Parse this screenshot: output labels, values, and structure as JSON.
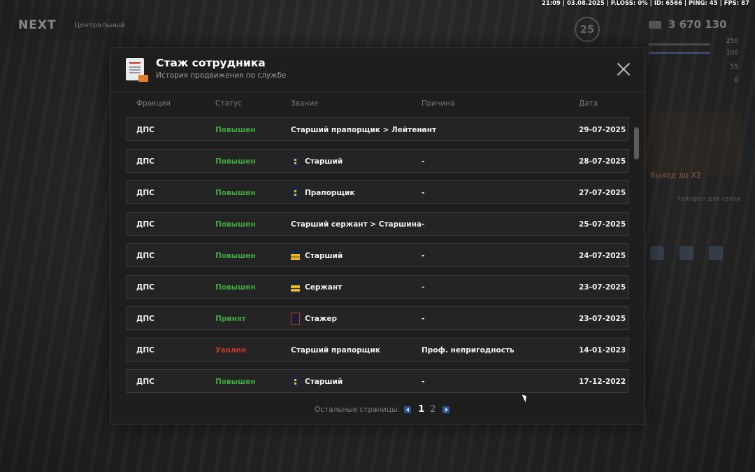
{
  "hud": {
    "status_line": "21:09 | 03.08.2025 | P.LOSS: 0% | ID: 6566 | PING: 45 | FPS: 87",
    "logo": "NEXT",
    "logo_sub": "Центральный",
    "level": "25",
    "money": "3 670 130",
    "stats": [
      "250",
      "100",
      "55",
      "0"
    ],
    "side_text": "Выход до X2",
    "side_text_2": "Телефон для связи"
  },
  "modal": {
    "title": "Стаж сотрудника",
    "subtitle": "История продвижения по службе",
    "columns": {
      "faction": "Фракция",
      "status": "Статус",
      "rank": "Звание",
      "reason": "Причина",
      "date": "Дата"
    },
    "rows": [
      {
        "faction": "ДПС",
        "status": "Повышен",
        "status_color": "#3fa83f",
        "rank_icon": "none",
        "rank": "Старший прапорщик > Лейтенант",
        "reason": "-",
        "date": "29-07-2025"
      },
      {
        "faction": "ДПС",
        "status": "Повышен",
        "status_color": "#3fa83f",
        "rank_icon": "star-shoulder-icon",
        "rank": "Старший",
        "reason": "-",
        "date": "28-07-2025"
      },
      {
        "faction": "ДПС",
        "status": "Повышен",
        "status_color": "#3fa83f",
        "rank_icon": "star-shoulder-icon",
        "rank": "Прапорщик",
        "reason": "-",
        "date": "27-07-2025"
      },
      {
        "faction": "ДПС",
        "status": "Повышен",
        "status_color": "#3fa83f",
        "rank_icon": "none",
        "rank": "Старший сержант > Старшина",
        "reason": "-",
        "date": "25-07-2025"
      },
      {
        "faction": "ДПС",
        "status": "Повышен",
        "status_color": "#3fa83f",
        "rank_icon": "stripe-shoulder-icon",
        "rank": "Старший",
        "reason": "-",
        "date": "24-07-2025"
      },
      {
        "faction": "ДПС",
        "status": "Повышен",
        "status_color": "#3fa83f",
        "rank_icon": "stripe-shoulder-icon",
        "rank": "Сержант",
        "reason": "-",
        "date": "23-07-2025"
      },
      {
        "faction": "ДПС",
        "status": "Принят",
        "status_color": "#3fa83f",
        "rank_icon": "plain-shoulder-icon",
        "rank": "Стажер",
        "reason": "-",
        "date": "23-07-2025"
      },
      {
        "faction": "ДПС",
        "status": "Уволен",
        "status_color": "#c0392b",
        "rank_icon": "none",
        "rank": "Старший прапорщик",
        "reason": "Проф. непригодность",
        "date": "14-01-2023"
      },
      {
        "faction": "ДПС",
        "status": "Повышен",
        "status_color": "#3fa83f",
        "rank_icon": "star-shoulder-icon",
        "rank": "Старший",
        "reason": "-",
        "date": "17-12-2022"
      }
    ],
    "pager": {
      "label": "Остальные страницы:",
      "pages": [
        "1",
        "2"
      ],
      "current": "1"
    }
  }
}
